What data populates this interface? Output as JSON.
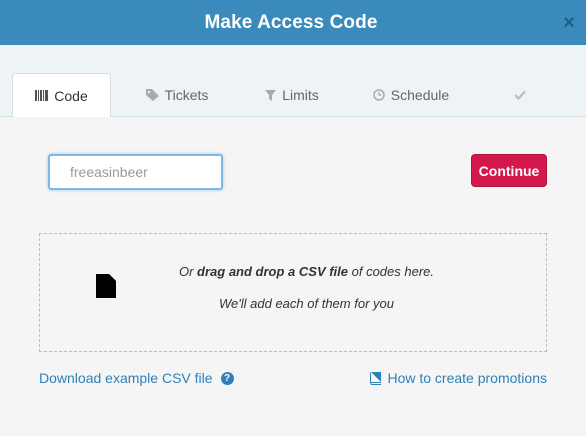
{
  "dialog": {
    "title": "Make Access Code",
    "close_label": "×"
  },
  "tabs": [
    {
      "label": "Code",
      "icon": "barcode-icon",
      "active": true
    },
    {
      "label": "Tickets",
      "icon": "ticket-icon",
      "active": false
    },
    {
      "label": "Limits",
      "icon": "filter-icon",
      "active": false
    },
    {
      "label": "Schedule",
      "icon": "clock-icon",
      "active": false
    },
    {
      "label": "",
      "icon": "check-icon",
      "active": false
    }
  ],
  "form": {
    "code_value": "freeasinbeer",
    "continue_label": "Continue"
  },
  "dropzone": {
    "prefix": "Or ",
    "bold": "drag and drop a CSV file",
    "suffix": " of codes here.",
    "subtext": "We'll add each of them for you"
  },
  "links": {
    "download_csv": "Download example CSV file",
    "how_to": "How to create promotions"
  },
  "colors": {
    "header": "#3a8bbb",
    "continue_button": "#d4184b",
    "link": "#2e80b8"
  }
}
